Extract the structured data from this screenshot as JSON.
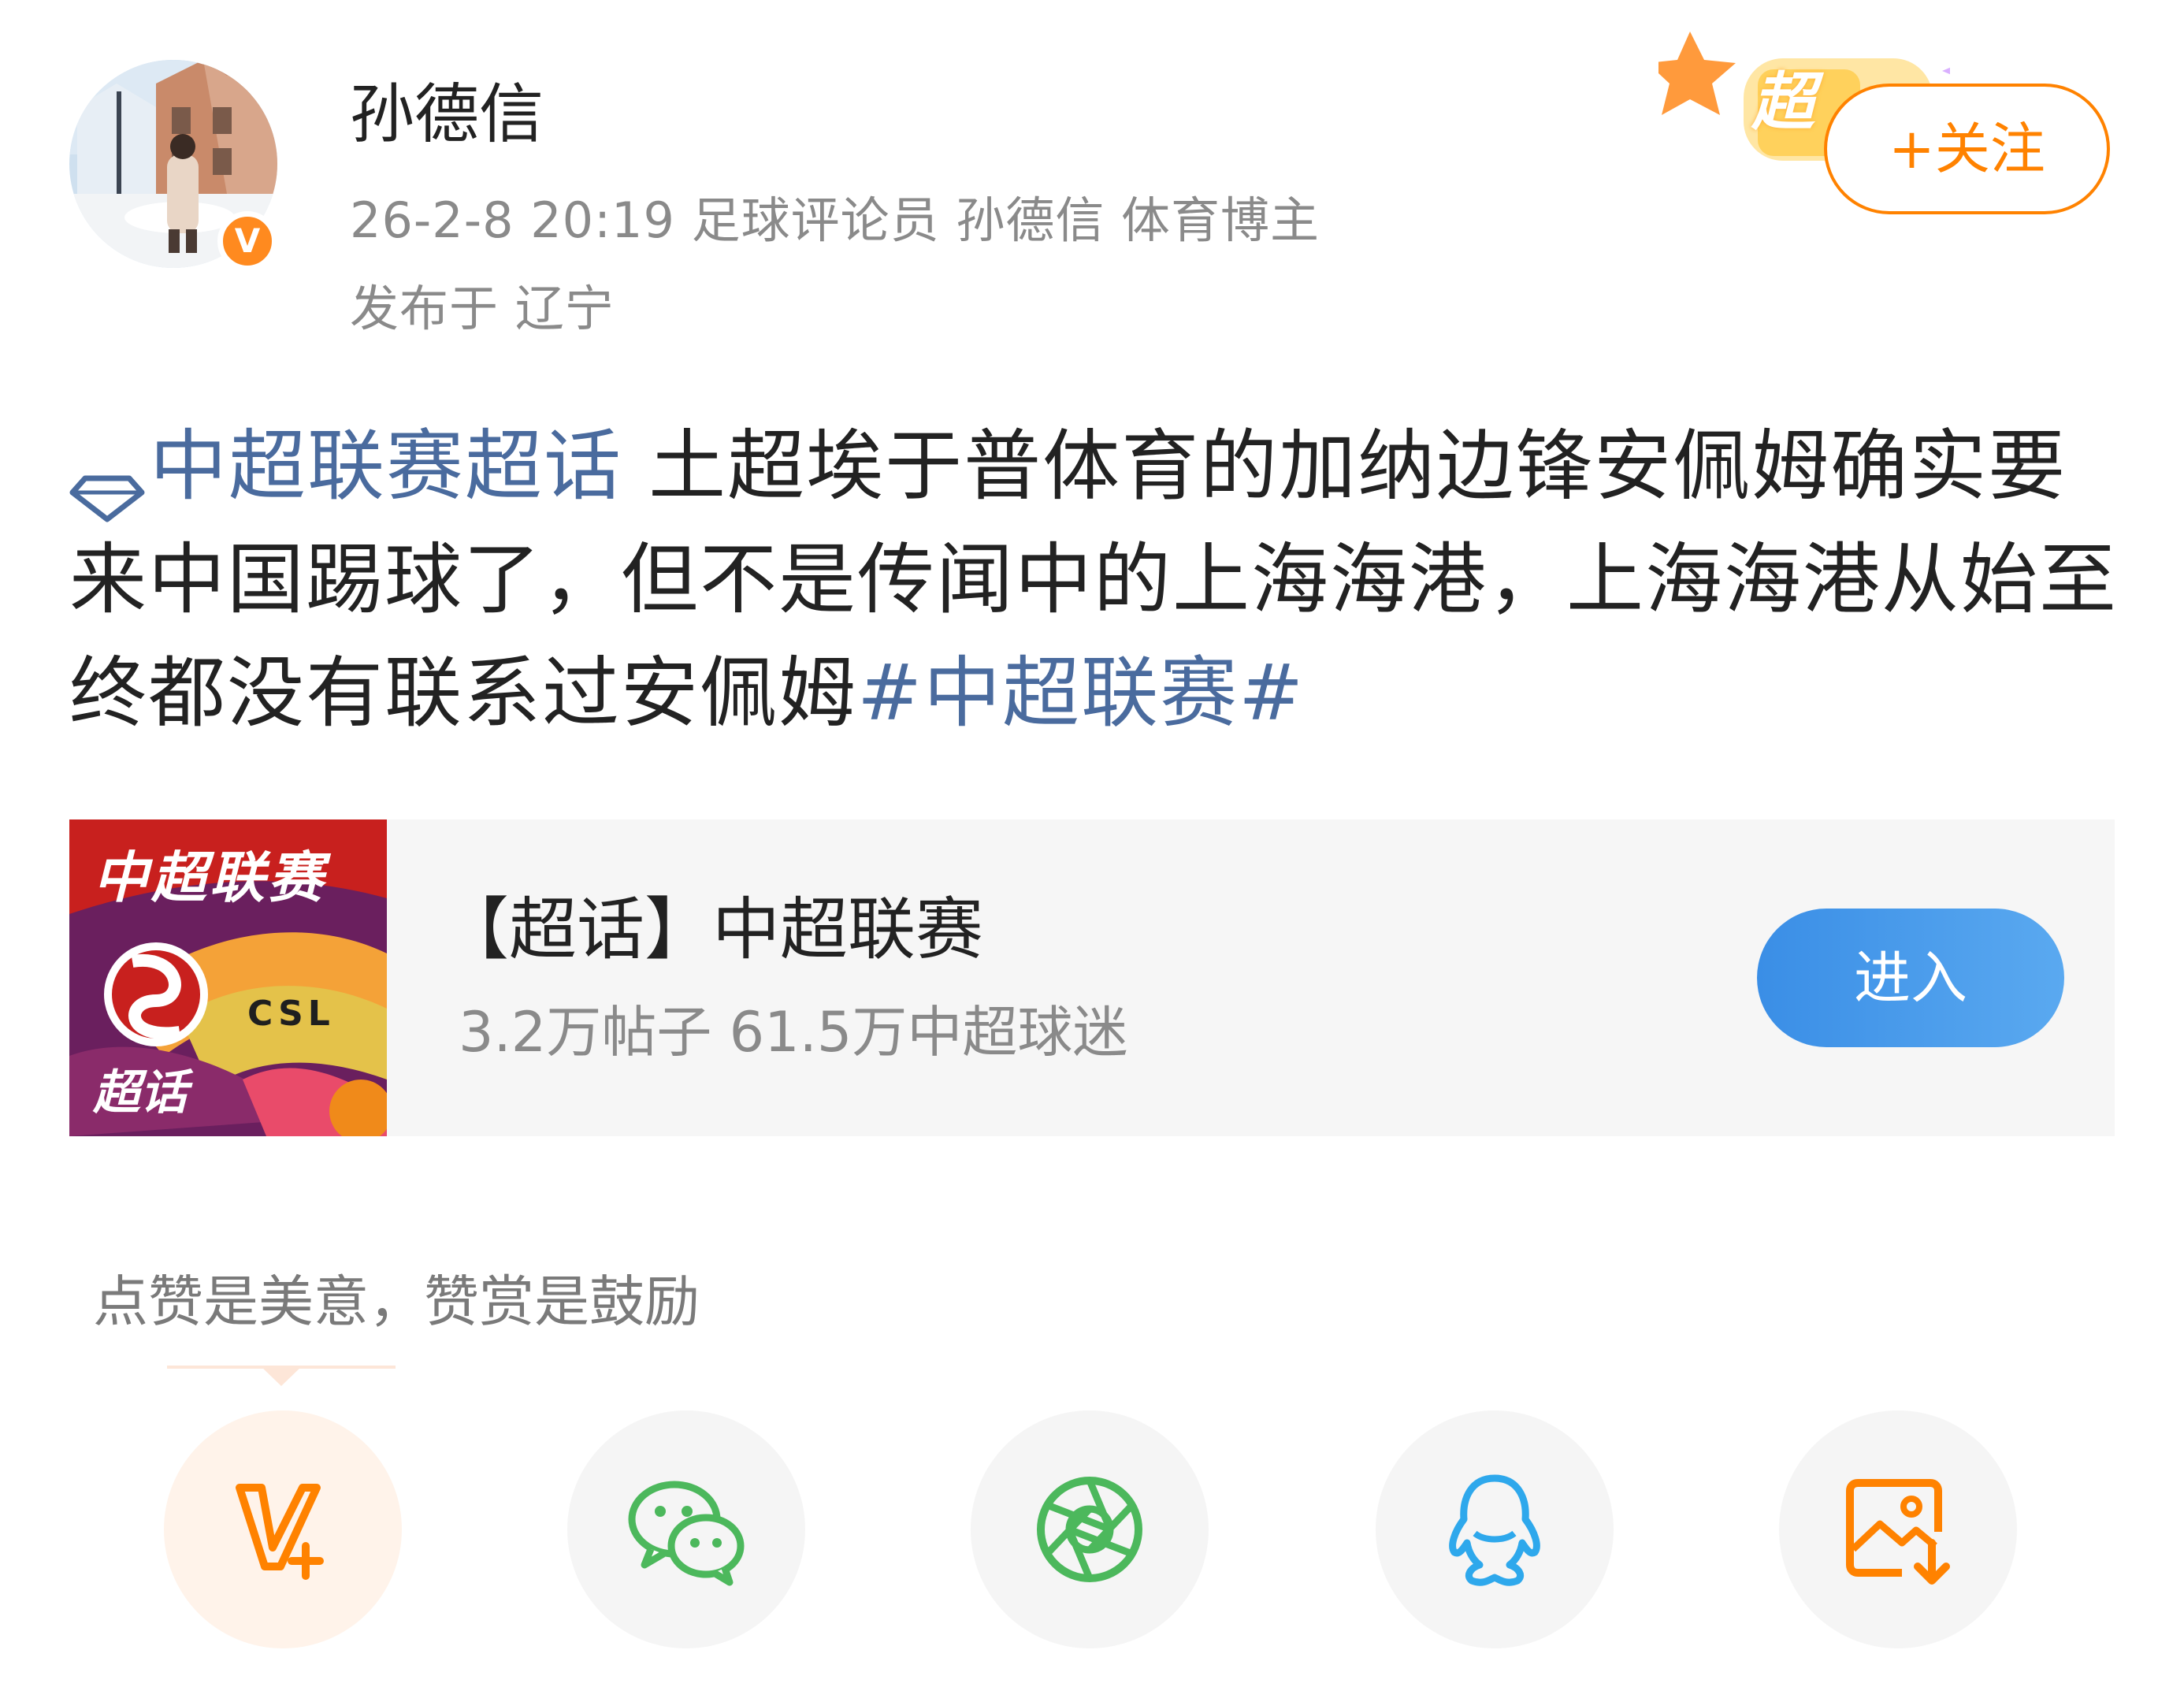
{
  "header": {
    "username": "孙德信",
    "avatar_badge": "V",
    "meta": "26-2-8 20:19  足球评论员 孙德信 体育博主",
    "location": "发布于 辽宁",
    "super_badge": "超",
    "follow_label": "+关注"
  },
  "post": {
    "topic_link": "中超联赛超话",
    "body": " 土超埃于普体育的加纳边锋安佩姆确实要来中国踢球了，但不是传闻中的上海海港，上海海港从始至终都没有联系过安佩姆",
    "hashtag": "#中超联赛#"
  },
  "card": {
    "image_title": "中超联赛",
    "image_tag": "CSL",
    "image_sub": "超话",
    "title": "【超话】中超联赛",
    "subtitle": "3.2万帖子 61.5万中超球迷",
    "enter_label": "进入"
  },
  "reward": {
    "hint": "点赞是美意，赞赏是鼓励"
  },
  "share": {
    "icons": [
      "vip-plus-icon",
      "wechat-icon",
      "moments-icon",
      "qq-icon",
      "save-image-icon"
    ]
  },
  "colors": {
    "accent_orange": "#ff8200",
    "link_blue": "#4a6b9e",
    "enter_blue": "#3a8ee6",
    "wechat_green": "#4cb85c",
    "qq_blue": "#2ea8ec"
  }
}
